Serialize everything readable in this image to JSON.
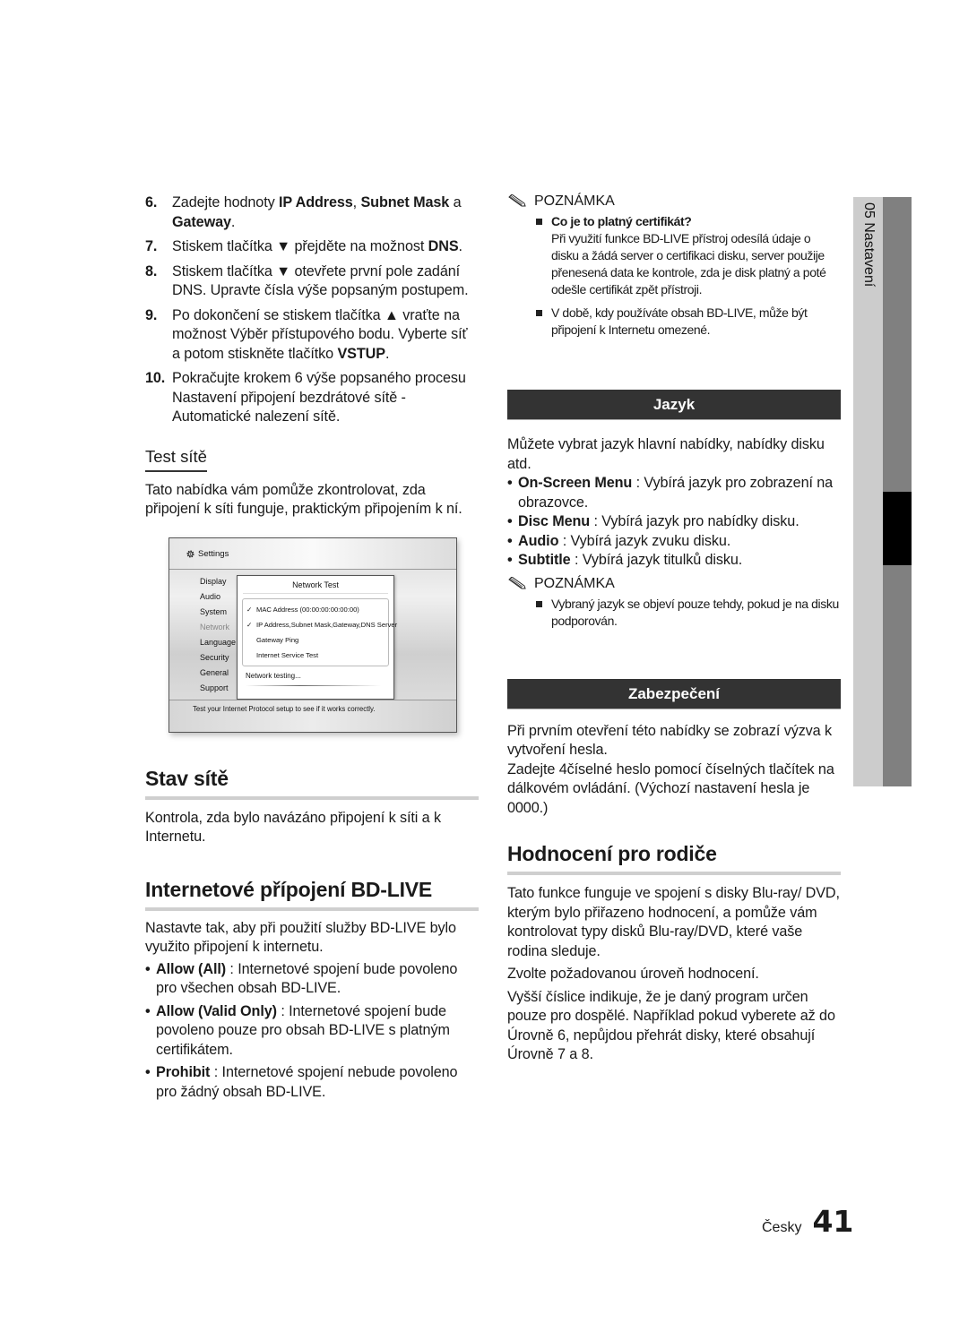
{
  "left_column": {
    "steps": [
      {
        "num": "6.",
        "parts": [
          {
            "t": "Zadejte hodnoty "
          },
          {
            "t": "IP Address",
            "b": true
          },
          {
            "t": ", "
          },
          {
            "t": "Subnet Mask",
            "b": true
          },
          {
            "t": " a "
          },
          {
            "t": "Gateway",
            "b": true
          },
          {
            "t": "."
          }
        ]
      },
      {
        "num": "7.",
        "parts": [
          {
            "t": "Stiskem tlačítka ▼ přejděte na možnost "
          },
          {
            "t": "DNS",
            "b": true
          },
          {
            "t": "."
          }
        ]
      },
      {
        "num": "8.",
        "parts": [
          {
            "t": "Stiskem tlačítka ▼ otevřete první pole zadání DNS. Upravte čísla výše popsaným postupem."
          }
        ]
      },
      {
        "num": "9.",
        "parts": [
          {
            "t": "Po dokončení se stiskem tlačítka ▲ vraťte na možnost Výběr přístupového bodu. Vyberte síť a potom stiskněte tlačítko "
          },
          {
            "t": "VSTUP",
            "b": true
          },
          {
            "t": "."
          }
        ]
      },
      {
        "num": "10.",
        "parts": [
          {
            "t": "Pokračujte krokem 6 výše popsaného procesu Nastavení připojení bezdrátové sítě - Automatické nalezení sítě."
          }
        ]
      }
    ],
    "test_site": {
      "heading": "Test sítě",
      "text": "Tato nabídka vám pomůže zkontrolovat, zda připojení k síti funguje, praktickým připojením k ní."
    },
    "screenshot": {
      "title": "Settings",
      "icon": "gear-icon",
      "menu": [
        {
          "label": "Display",
          "dim": false
        },
        {
          "label": "Audio",
          "dim": false
        },
        {
          "label": "System",
          "dim": false
        },
        {
          "label": "Network",
          "dim": true
        },
        {
          "label": "Language",
          "dim": false
        },
        {
          "label": "Security",
          "dim": false
        },
        {
          "label": "General",
          "dim": false
        },
        {
          "label": "Support",
          "dim": false
        }
      ],
      "dialog_title": "Network Test",
      "dialog_items": [
        {
          "label": "MAC Address (00:00:00:00:00:00)",
          "checked": true
        },
        {
          "label": "IP Address,Subnet Mask,Gateway,DNS Server",
          "checked": true
        },
        {
          "label": "Gateway Ping",
          "checked": false
        },
        {
          "label": "Internet Service Test",
          "checked": false
        }
      ],
      "status": "Network testing...",
      "help_text": "Test your Internet Protocol setup to see if it works correctly."
    },
    "stav_site": {
      "heading": "Stav sítě",
      "text": "Kontrola, zda bylo navázáno připojení k síti a k Internetu."
    },
    "bdlive": {
      "heading": "Internetové přípojení BD-LIVE",
      "text": "Nastavte tak, aby při použití služby BD-LIVE bylo využito připojení k internetu.",
      "bullets": [
        {
          "term": "Allow (All)",
          "desc": " : Internetové spojení bude povoleno pro všechen obsah BD-LIVE."
        },
        {
          "term": "Allow (Valid Only)",
          "desc": " : Internetové spojení bude povoleno pouze pro obsah BD-LIVE s platným certifikátem."
        },
        {
          "term": "Prohibit",
          "desc": " : Internetové spojení nebude povoleno pro žádný obsah BD-LIVE."
        }
      ]
    }
  },
  "right_column": {
    "note1": {
      "heading": "POZNÁMKA",
      "items": [
        {
          "title": "Co je to platný certifikát?",
          "text": "Při využití funkce BD-LIVE přístroj odesílá údaje o disku a žádá server o certifikaci disku, server použije přenesená data ke kontrole, zda je disk platný a poté odešle certifikát zpět přístroji."
        },
        {
          "title": "",
          "text": "V době, kdy používáte obsah BD-LIVE, může být připojení k Internetu omezené."
        }
      ]
    },
    "jazyk": {
      "heading": "Jazyk",
      "text": "Můžete vybrat jazyk hlavní nabídky, nabídky disku atd.",
      "bullets": [
        {
          "term": "On-Screen Menu",
          "desc": " : Vybírá jazyk pro zobrazení na obrazovce."
        },
        {
          "term": "Disc Menu",
          "desc": " : Vybírá jazyk pro nabídky disku."
        },
        {
          "term": "Audio",
          "desc": " : Vybírá jazyk zvuku disku."
        },
        {
          "term": "Subtitle",
          "desc": " : Vybírá jazyk titulků disku."
        }
      ]
    },
    "note2": {
      "heading": "POZNÁMKA",
      "items": [
        {
          "title": "",
          "text": "Vybraný jazyk se objeví pouze tehdy, pokud je na disku podporován."
        }
      ]
    },
    "zabezpeceni": {
      "heading": "Zabezpečení",
      "text1": "Při prvním otevření této nabídky se zobrazí výzva k vytvoření hesla.",
      "text2": "Zadejte 4číselné heslo pomocí číselných tlačítek na dálkovém ovládání. (Výchozí nastavení hesla je 0000.)"
    },
    "hodnoceni": {
      "heading": "Hodnocení pro rodiče",
      "paragraphs": [
        "Tato funkce funguje ve spojení s disky Blu-ray/ DVD, kterým bylo přiřazeno hodnocení, a pomůže vám kontrolovat typy disků Blu-ray/DVD, které vaše rodina sleduje.",
        "Zvolte požadovanou úroveň hodnocení.",
        "Vyšší číslice indikuje, že je daný program určen pouze pro dospělé. Například pokud vyberete až do Úrovně 6, nepůjdou přehrát disky, které obsahují Úrovně 7 a 8."
      ]
    }
  },
  "side_tab": {
    "label": "05  Nastavení"
  },
  "footer": {
    "language": "Česky",
    "page_number": "41"
  },
  "colors": {
    "section_bar": "#333333",
    "heading_rule": "#cfcfcf",
    "tab_light": "#cccccc",
    "tab_dark": "#808080",
    "tab_active": "#000000"
  }
}
